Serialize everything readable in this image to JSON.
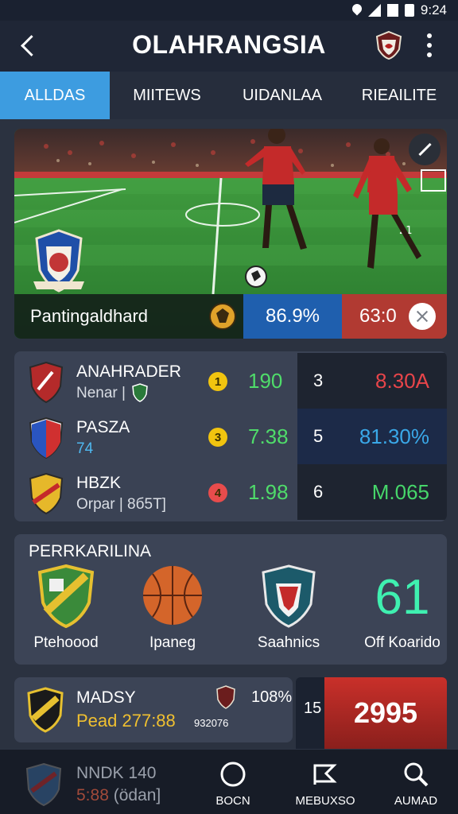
{
  "status_bar": {
    "time": "9:24"
  },
  "header": {
    "title": "OLAHRANGSIA"
  },
  "tabs": [
    {
      "label": "ALLDAS",
      "active": true
    },
    {
      "label": "MIITEWS",
      "active": false
    },
    {
      "label": "UIDANLAA",
      "active": false
    },
    {
      "label": "RIEAILITE",
      "active": false
    }
  ],
  "hero": {
    "team": "Pantingaldhard",
    "percent": "86.9%",
    "score": "63:0",
    "jersey_number": "21"
  },
  "standings": [
    {
      "name": "ANAHRADER",
      "sub": "Nenar |",
      "rank": "1",
      "odd": "190",
      "num": "3",
      "value": "8.30A",
      "value_color": "#e8454a",
      "rank_color": "#f1c40f"
    },
    {
      "name": "PASZA",
      "sub": "74",
      "rank": "3",
      "odd": "7.38",
      "num": "5",
      "value": "81.30%",
      "value_color": "#3aa8e8",
      "rank_color": "#f1c40f"
    },
    {
      "name": "HBZK",
      "sub": "Orpar | 8б5T]",
      "rank": "4",
      "odd": "1.98",
      "num": "6",
      "value": "M.065",
      "value_color": "#46d66a",
      "rank_color": "#e84c4c"
    }
  ],
  "featured": {
    "title": "PERRKARILINA",
    "items": [
      {
        "label": "Ptehoood"
      },
      {
        "label": "Ipaneg"
      },
      {
        "label": "Saahnics"
      }
    ],
    "stat_value": "61",
    "stat_label": "Off Koarido"
  },
  "match": {
    "name": "MADSY",
    "sub": "Pead 277:88",
    "percent": "108%",
    "extra": "932076",
    "rank": "15",
    "score": "2995"
  },
  "bottom_nav": {
    "promo_title": "NNDK 140",
    "promo_sub_red": "5:88",
    "promo_sub": "(ödan]",
    "items": [
      {
        "label": "BOCN",
        "icon": "circle-icon"
      },
      {
        "label": "MEBUXSO",
        "icon": "flag-icon"
      },
      {
        "label": "AUMAD",
        "icon": "search-icon"
      }
    ]
  },
  "colors": {
    "accent_tab": "#3d9ce0",
    "odd_green": "#4fdc6a",
    "stat_teal": "#3ff0b0",
    "score_red": "#c9302a"
  }
}
